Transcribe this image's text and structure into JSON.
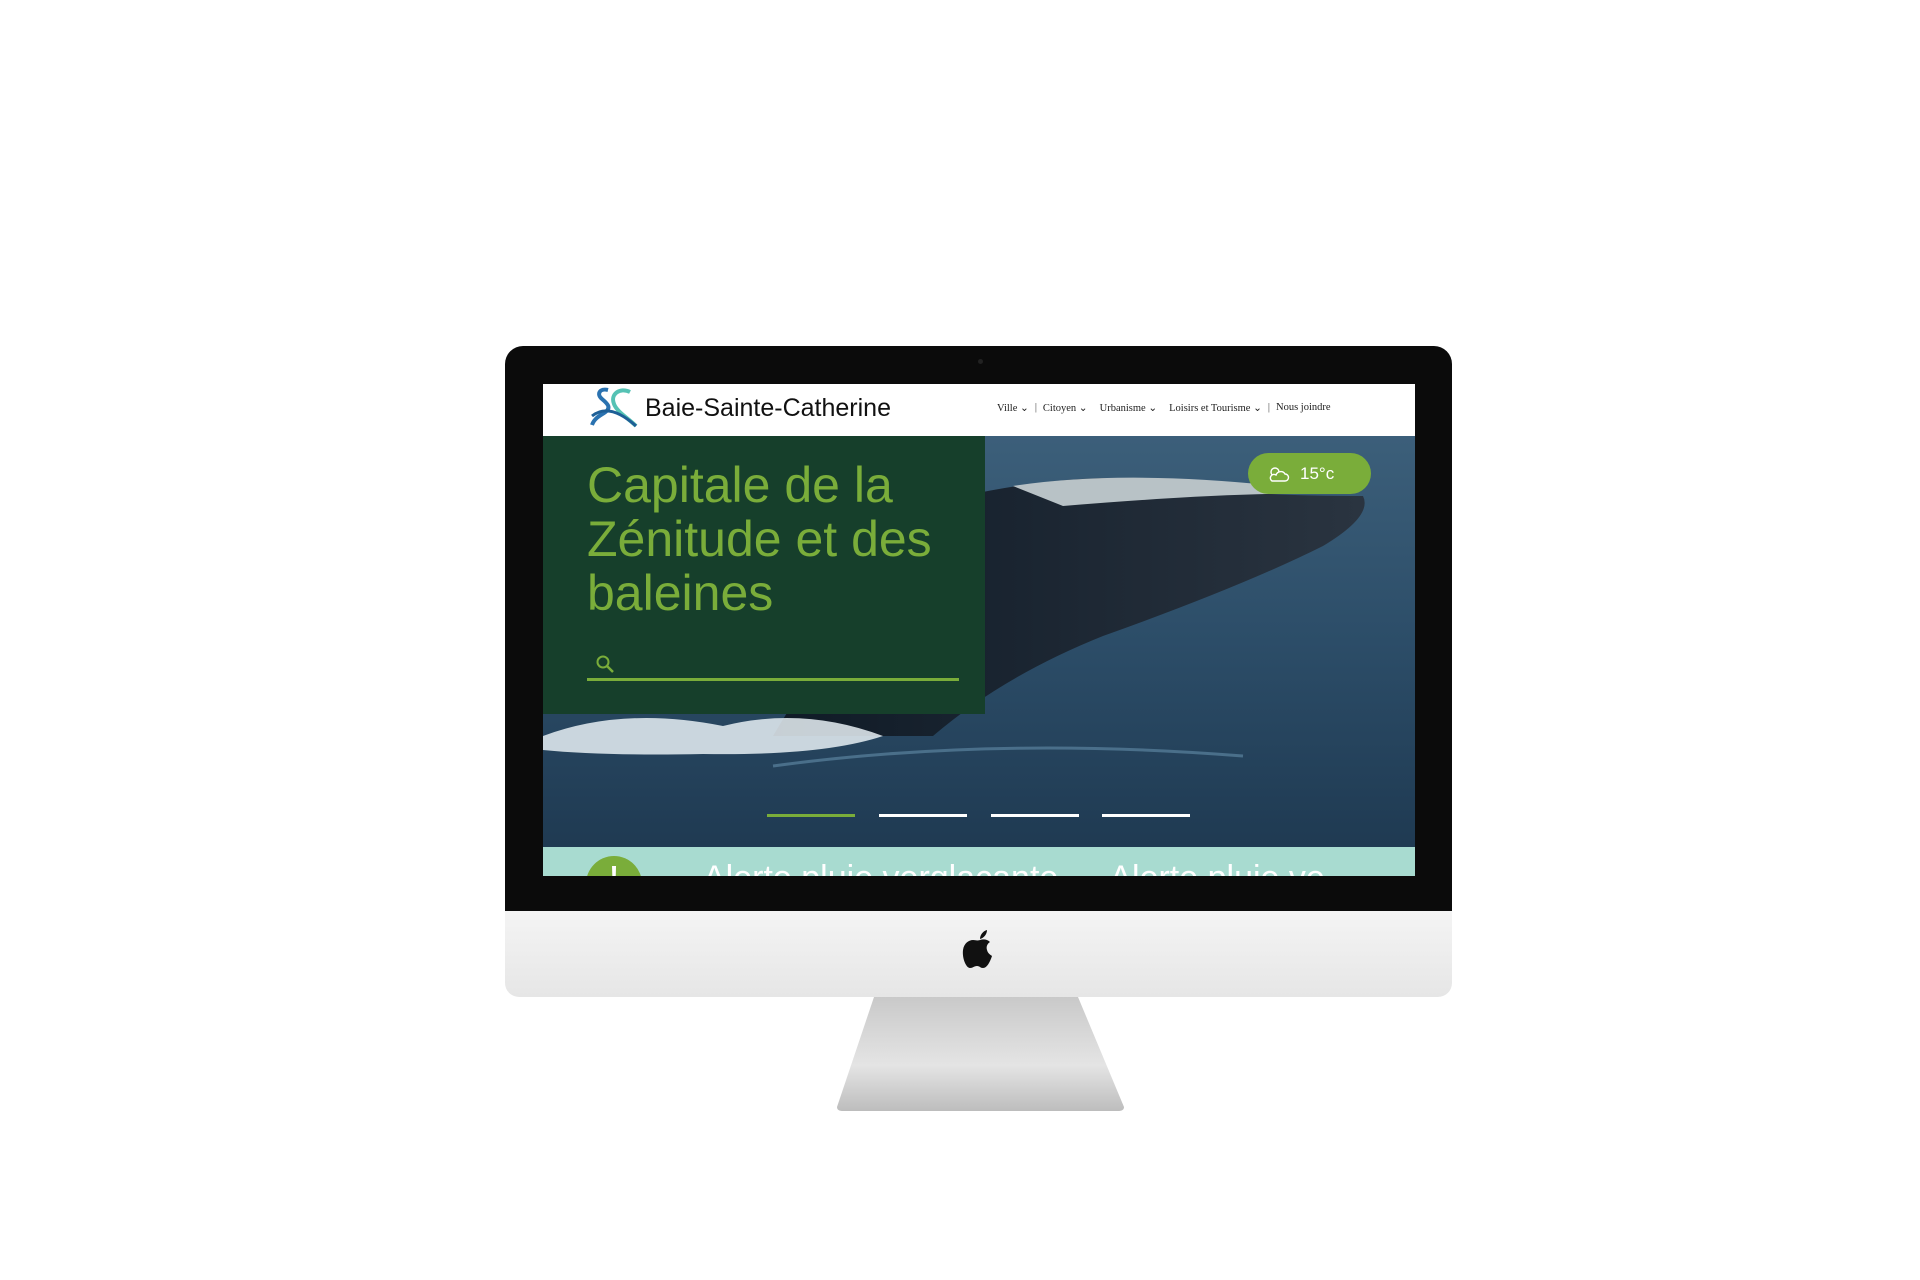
{
  "site": {
    "title": "Baie-Sainte-Catherine"
  },
  "nav": {
    "items": [
      {
        "label": "Ville"
      },
      {
        "label": "Citoyen"
      },
      {
        "label": "Urbanisme"
      },
      {
        "label": "Loisirs et Tourisme"
      },
      {
        "label": "Nous joindre"
      }
    ]
  },
  "hero": {
    "headline": "Capitale de la Zénitude et des baleines",
    "weather": "15°c",
    "slides": 4,
    "active_slide": 1
  },
  "alert": {
    "icon": "!",
    "text": "Alerte pluie verglaçante — Alerte pluie ve"
  },
  "colors": {
    "accent": "#7aad3a",
    "panel": "#163f2b",
    "alert_bg": "#a8dbd0"
  }
}
